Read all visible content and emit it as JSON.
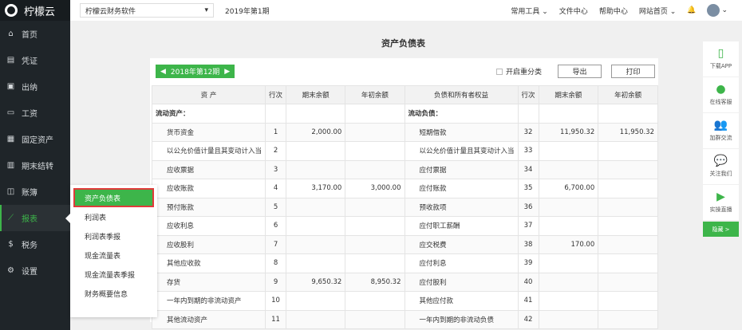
{
  "app": {
    "name": "柠檬云"
  },
  "sidebar": {
    "items": [
      {
        "label": "首页",
        "icon": "home-icon",
        "glyph": "⌂"
      },
      {
        "label": "凭证",
        "icon": "voucher-icon",
        "glyph": "▤"
      },
      {
        "label": "出纳",
        "icon": "cashier-icon",
        "glyph": "▣"
      },
      {
        "label": "工资",
        "icon": "salary-icon",
        "glyph": "▭"
      },
      {
        "label": "固定资产",
        "icon": "asset-icon",
        "glyph": "▦"
      },
      {
        "label": "期末结转",
        "icon": "calendar-icon",
        "glyph": "▥"
      },
      {
        "label": "账簿",
        "icon": "book-icon",
        "glyph": "◫"
      },
      {
        "label": "报表",
        "icon": "chart-icon",
        "glyph": "⟋"
      },
      {
        "label": "税务",
        "icon": "tax-icon",
        "glyph": "$"
      },
      {
        "label": "设置",
        "icon": "gear-icon",
        "glyph": "⚙"
      }
    ],
    "active": "报表"
  },
  "topbar": {
    "account": "柠檬云财务软件",
    "period": "2019年第1期",
    "nav": [
      "常用工具 ⌄",
      "文件中心",
      "帮助中心",
      "网站首页 ⌄"
    ]
  },
  "page": {
    "title": "资产负债表",
    "period": "2018年第12期",
    "reclassify": "开启重分类",
    "export": "导出",
    "print": "打印"
  },
  "table": {
    "headers": [
      "资 产",
      "行次",
      "期末余额",
      "年初余额",
      "负债和所有者权益",
      "行次",
      "期末余额",
      "年初余额"
    ],
    "rows": [
      [
        "流动资产：",
        "",
        "",
        "",
        "流动负债：",
        "",
        "",
        ""
      ],
      [
        "货币资金",
        "1",
        "2,000.00",
        "",
        "短期借款",
        "32",
        "11,950.32",
        "11,950.32"
      ],
      [
        "以公允价值计量且其变动计入当",
        "2",
        "",
        "",
        "以公允价值计量且其变动计入当",
        "33",
        "",
        ""
      ],
      [
        "应收票据",
        "3",
        "",
        "",
        "应付票据",
        "34",
        "",
        ""
      ],
      [
        "应收账款",
        "4",
        "3,170.00",
        "3,000.00",
        "应付账款",
        "35",
        "6,700.00",
        ""
      ],
      [
        "预付账款",
        "5",
        "",
        "",
        "预收款项",
        "36",
        "",
        ""
      ],
      [
        "应收利息",
        "6",
        "",
        "",
        "应付职工薪酬",
        "37",
        "",
        ""
      ],
      [
        "应收股利",
        "7",
        "",
        "",
        "应交税费",
        "38",
        "170.00",
        ""
      ],
      [
        "其他应收款",
        "8",
        "",
        "",
        "应付利息",
        "39",
        "",
        ""
      ],
      [
        "存货",
        "9",
        "9,650.32",
        "8,950.32",
        "应付股利",
        "40",
        "",
        ""
      ],
      [
        "一年内到期的非流动资产",
        "10",
        "",
        "",
        "其他应付款",
        "41",
        "",
        ""
      ],
      [
        "其他流动资产",
        "11",
        "",
        "",
        "一年内到期的非流动负债",
        "42",
        "",
        ""
      ]
    ]
  },
  "report_menu": {
    "items": [
      "资产负债表",
      "利润表",
      "利润表季报",
      "现金流量表",
      "现金流量表季报",
      "财务概要信息"
    ],
    "active": "资产负债表"
  },
  "right_panel": {
    "items": [
      {
        "label": "下载APP",
        "icon": "phone-icon",
        "glyph": "▯"
      },
      {
        "label": "在线客服",
        "icon": "qq-icon",
        "glyph": "●"
      },
      {
        "label": "加群交流",
        "icon": "group-icon",
        "glyph": "👥"
      },
      {
        "label": "关注我们",
        "icon": "wechat-icon",
        "glyph": "💬"
      },
      {
        "label": "实操直播",
        "icon": "video-icon",
        "glyph": "▶"
      }
    ],
    "hide": "隐藏 >"
  },
  "colors": {
    "accent": "#3db54a",
    "sidebar": "#1f2529",
    "highlight": "#e03a3a"
  }
}
